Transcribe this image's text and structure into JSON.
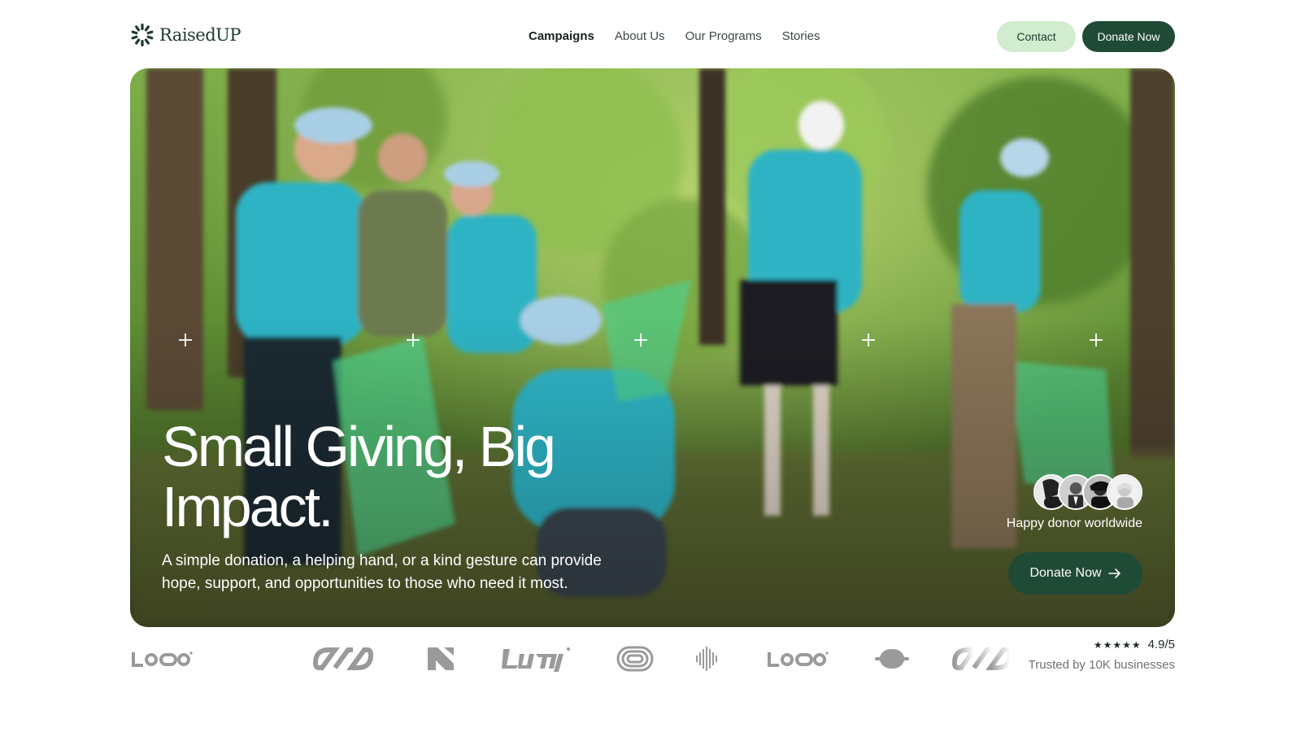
{
  "brand": {
    "name": "RaisedUP",
    "logo_icon": "sunburst-icon",
    "color": "#1e3a2c"
  },
  "nav": {
    "items": [
      {
        "label": "Campaigns",
        "active": true
      },
      {
        "label": "About Us",
        "active": false
      },
      {
        "label": "Our Programs",
        "active": false
      },
      {
        "label": "Stories",
        "active": false
      }
    ]
  },
  "header_actions": {
    "contact_label": "Contact",
    "donate_label": "Donate Now"
  },
  "hero": {
    "title": "Small Giving, Big Impact.",
    "subtitle": "A simple donation, a helping hand, or a kind gesture can provide hope, support, and opportunities to those who need it most.",
    "donor_label": "Happy donor worldwide",
    "cta_label": "Donate Now",
    "cta_icon": "arrow-right-icon"
  },
  "partner_logos": [
    "logoipsum-wordmark",
    "chain-links",
    "n-monogram",
    "logoipsum-script",
    "concentric-rings",
    "soundwave",
    "logoipsum-wordmark",
    "saturn-ring",
    "chain-links"
  ],
  "rating": {
    "stars": "★★★★★",
    "score": "4.9/5",
    "trusted_text": "Trusted by 10K businesses"
  },
  "colors": {
    "accent_dark": "#1f4a36",
    "accent_light": "#d2ecd0",
    "volunteer_shirt": "#2fb3c4"
  }
}
